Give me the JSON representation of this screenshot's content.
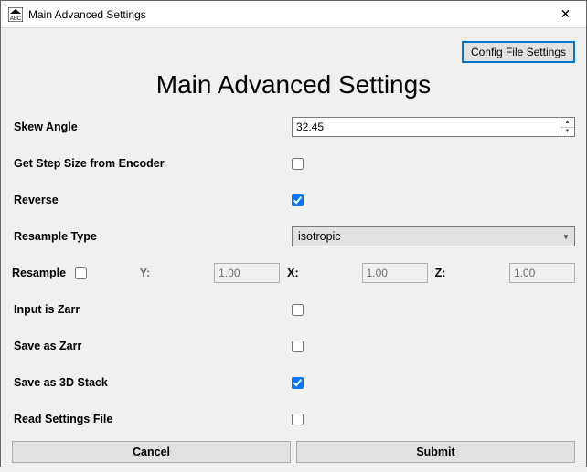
{
  "window": {
    "title": "Main Advanced Settings",
    "close_glyph": "✕"
  },
  "top": {
    "config_file_settings_label": "Config File Settings"
  },
  "heading": "Main Advanced Settings",
  "fields": {
    "skew_angle": {
      "label": "Skew Angle",
      "value": "32.45"
    },
    "get_step_size": {
      "label": "Get Step Size from Encoder",
      "checked": false
    },
    "reverse": {
      "label": "Reverse",
      "checked": true
    },
    "resample_type": {
      "label": "Resample Type",
      "value": "isotropic"
    },
    "resample": {
      "label": "Resample",
      "checked": false,
      "y": {
        "label": "Y:",
        "value": "1.00"
      },
      "x": {
        "label": "X:",
        "value": "1.00"
      },
      "z": {
        "label": "Z:",
        "value": "1.00"
      }
    },
    "input_is_zarr": {
      "label": "Input is Zarr",
      "checked": false
    },
    "save_as_zarr": {
      "label": "Save as Zarr",
      "checked": false
    },
    "save_as_3d_stack": {
      "label": "Save as 3D Stack",
      "checked": true
    },
    "read_settings_file": {
      "label": "Read Settings File",
      "checked": false
    }
  },
  "buttons": {
    "cancel": "Cancel",
    "submit": "Submit"
  }
}
